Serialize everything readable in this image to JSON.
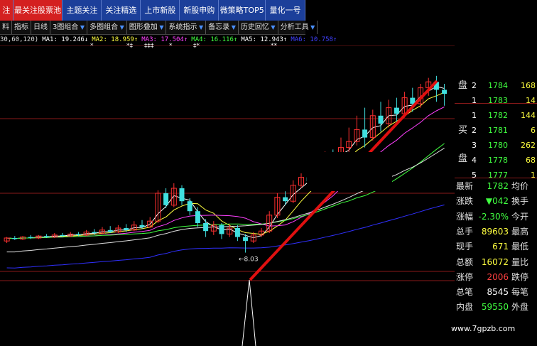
{
  "nav_tabs": [
    {
      "label": "注",
      "active": true
    },
    {
      "label": "最关注股票池",
      "active": true
    },
    {
      "label": "主题关注",
      "active": false
    },
    {
      "label": "关注精选",
      "active": false
    },
    {
      "label": "上市新股",
      "active": false
    },
    {
      "label": "新股申购",
      "active": false
    },
    {
      "label": "微策略TOP5",
      "active": false
    },
    {
      "label": "量化一号",
      "active": false
    }
  ],
  "toolbar": [
    "料",
    "指标",
    "日线",
    "3图组合",
    "多图组合",
    "图形叠加",
    "系统指示",
    "备忘录",
    "历史回忆",
    "分析工具"
  ],
  "ma_bar": {
    "prefix": "30,60,120)",
    "items": [
      {
        "label": "MA1: 19.246",
        "arrow": "↓",
        "color": "#ffffff"
      },
      {
        "label": "MA2: 18.959",
        "arrow": "↑",
        "color": "#ffff40"
      },
      {
        "label": "MA3: 17.504",
        "arrow": "↑",
        "color": "#ff40ff"
      },
      {
        "label": "MA4: 16.116",
        "arrow": "↑",
        "color": "#40ff40"
      },
      {
        "label": "MA5: 12.943",
        "arrow": "↑",
        "color": "#ffffff"
      },
      {
        "label": "MA6: 10.758",
        "arrow": "↑",
        "color": "#4040ff"
      }
    ]
  },
  "chart_data": {
    "type": "candlestick",
    "low_label": "8.03",
    "price_min": 6.0,
    "price_max": 26.0,
    "candles": [
      [
        9.2,
        9.5,
        9.0,
        9.6
      ],
      [
        9.5,
        9.4,
        9.3,
        9.7
      ],
      [
        9.4,
        9.6,
        9.3,
        9.7
      ],
      [
        9.6,
        9.5,
        9.4,
        9.8
      ],
      [
        9.5,
        9.7,
        9.4,
        9.8
      ],
      [
        9.7,
        9.6,
        9.5,
        9.9
      ],
      [
        9.6,
        9.8,
        9.5,
        10.0
      ],
      [
        9.8,
        9.7,
        9.6,
        10.0
      ],
      [
        9.7,
        9.9,
        9.6,
        10.1
      ],
      [
        9.9,
        9.8,
        9.7,
        10.1
      ],
      [
        9.8,
        10.1,
        9.7,
        10.3
      ],
      [
        10.1,
        10.0,
        9.8,
        10.4
      ],
      [
        10.0,
        10.3,
        9.9,
        10.6
      ],
      [
        10.3,
        10.1,
        10.0,
        10.7
      ],
      [
        10.1,
        10.5,
        10.0,
        10.8
      ],
      [
        10.5,
        10.3,
        10.1,
        10.9
      ],
      [
        10.3,
        10.8,
        10.2,
        11.2
      ],
      [
        10.8,
        10.6,
        10.4,
        11.3
      ],
      [
        10.6,
        11.2,
        10.5,
        11.6
      ],
      [
        11.2,
        14.0,
        11.0,
        14.3
      ],
      [
        14.0,
        12.8,
        12.5,
        14.5
      ],
      [
        12.8,
        14.5,
        12.6,
        15.0
      ],
      [
        14.5,
        13.2,
        12.8,
        14.8
      ],
      [
        13.2,
        12.2,
        11.8,
        13.5
      ],
      [
        12.2,
        11.0,
        10.6,
        12.6
      ],
      [
        11.0,
        10.2,
        9.6,
        11.4
      ],
      [
        10.2,
        10.8,
        9.8,
        11.2
      ],
      [
        10.8,
        9.9,
        9.4,
        11.0
      ],
      [
        9.9,
        10.5,
        9.6,
        10.9
      ],
      [
        10.5,
        9.6,
        9.2,
        10.8
      ],
      [
        9.6,
        9.2,
        8.03,
        9.9
      ],
      [
        9.2,
        9.8,
        9.0,
        10.1
      ],
      [
        9.8,
        10.2,
        9.6,
        10.5
      ],
      [
        10.2,
        11.8,
        10.0,
        12.2
      ],
      [
        11.8,
        13.6,
        11.5,
        14.0
      ],
      [
        13.6,
        13.2,
        12.8,
        14.2
      ],
      [
        13.2,
        14.8,
        13.0,
        15.3
      ],
      [
        14.8,
        15.6,
        14.5,
        16.0
      ],
      [
        15.6,
        15.2,
        14.8,
        16.2
      ],
      [
        15.2,
        16.6,
        15.0,
        17.0
      ],
      [
        16.6,
        17.8,
        16.3,
        18.2
      ],
      [
        17.8,
        17.2,
        16.8,
        18.4
      ],
      [
        17.2,
        18.6,
        17.0,
        19.6
      ],
      [
        18.6,
        19.2,
        17.8,
        20.6
      ],
      [
        19.2,
        20.4,
        18.8,
        21.8
      ],
      [
        20.4,
        19.6,
        18.6,
        22.6
      ],
      [
        19.6,
        21.8,
        19.3,
        22.4
      ],
      [
        21.8,
        21.0,
        20.2,
        23.2
      ],
      [
        21.0,
        22.6,
        20.6,
        23.4
      ],
      [
        22.6,
        22.0,
        21.2,
        23.6
      ],
      [
        22.0,
        23.6,
        21.6,
        24.2
      ],
      [
        23.6,
        23.0,
        22.2,
        24.6
      ],
      [
        23.0,
        24.6,
        22.6,
        25.0
      ],
      [
        24.6,
        25.2,
        23.8,
        25.6
      ],
      [
        25.2,
        24.4,
        23.2,
        25.8
      ],
      [
        24.4,
        24.0,
        22.8,
        25.0
      ]
    ],
    "ma_lines": [
      {
        "name": "MA1",
        "color": "#ffffff",
        "period": 3
      },
      {
        "name": "MA2",
        "color": "#ffff40",
        "period": 6
      },
      {
        "name": "MA3",
        "color": "#ff40ff",
        "period": 12
      },
      {
        "name": "MA4",
        "color": "#40ff40",
        "period": 24
      },
      {
        "name": "MA5",
        "color": "#e0e0e0",
        "period": 30
      },
      {
        "name": "MA6",
        "color": "#3030ff",
        "period": 60
      }
    ]
  },
  "order_book": {
    "sell_label": "盘",
    "buy_label_1": "买",
    "buy_label_2": "盘",
    "sell": [
      {
        "level": "2",
        "price": "1784",
        "vol": "168"
      },
      {
        "level": "1",
        "price": "1783",
        "vol": "14"
      }
    ],
    "buy": [
      {
        "level": "1",
        "price": "1782",
        "vol": "144"
      },
      {
        "level": "2",
        "price": "1781",
        "vol": "6"
      },
      {
        "level": "3",
        "price": "1780",
        "vol": "262"
      },
      {
        "level": "4",
        "price": "1778",
        "vol": "68"
      },
      {
        "level": "5",
        "price": "1777",
        "vol": "1"
      }
    ]
  },
  "quote": [
    {
      "label": "最新",
      "value": "1782",
      "value_color": "#40ff40",
      "label2": "均价"
    },
    {
      "label": "涨跌",
      "value": "▼042",
      "value_color": "#40ff40",
      "label2": "换手"
    },
    {
      "label": "涨幅",
      "value": "-2.30%",
      "value_color": "#40ff40",
      "label2": "今开"
    },
    {
      "label": "总手",
      "value": "89603",
      "value_color": "#ffff40",
      "label2": "最高"
    },
    {
      "label": "现手",
      "value": "671",
      "value_color": "#ffff40",
      "label2": "最低"
    },
    {
      "label": "总额",
      "value": "16072",
      "value_color": "#ffff40",
      "label2": "量比"
    },
    {
      "label": "涨停",
      "value": "2006",
      "value_color": "#ff4040",
      "label2": "跌停"
    },
    {
      "label": "总笔",
      "value": "8545",
      "value_color": "#ffffff",
      "label2": "每笔"
    },
    {
      "label": "内盘",
      "value": "59550",
      "value_color": "#40ff40",
      "label2": "外盘"
    }
  ],
  "watermark": "www.7gpzb.com"
}
